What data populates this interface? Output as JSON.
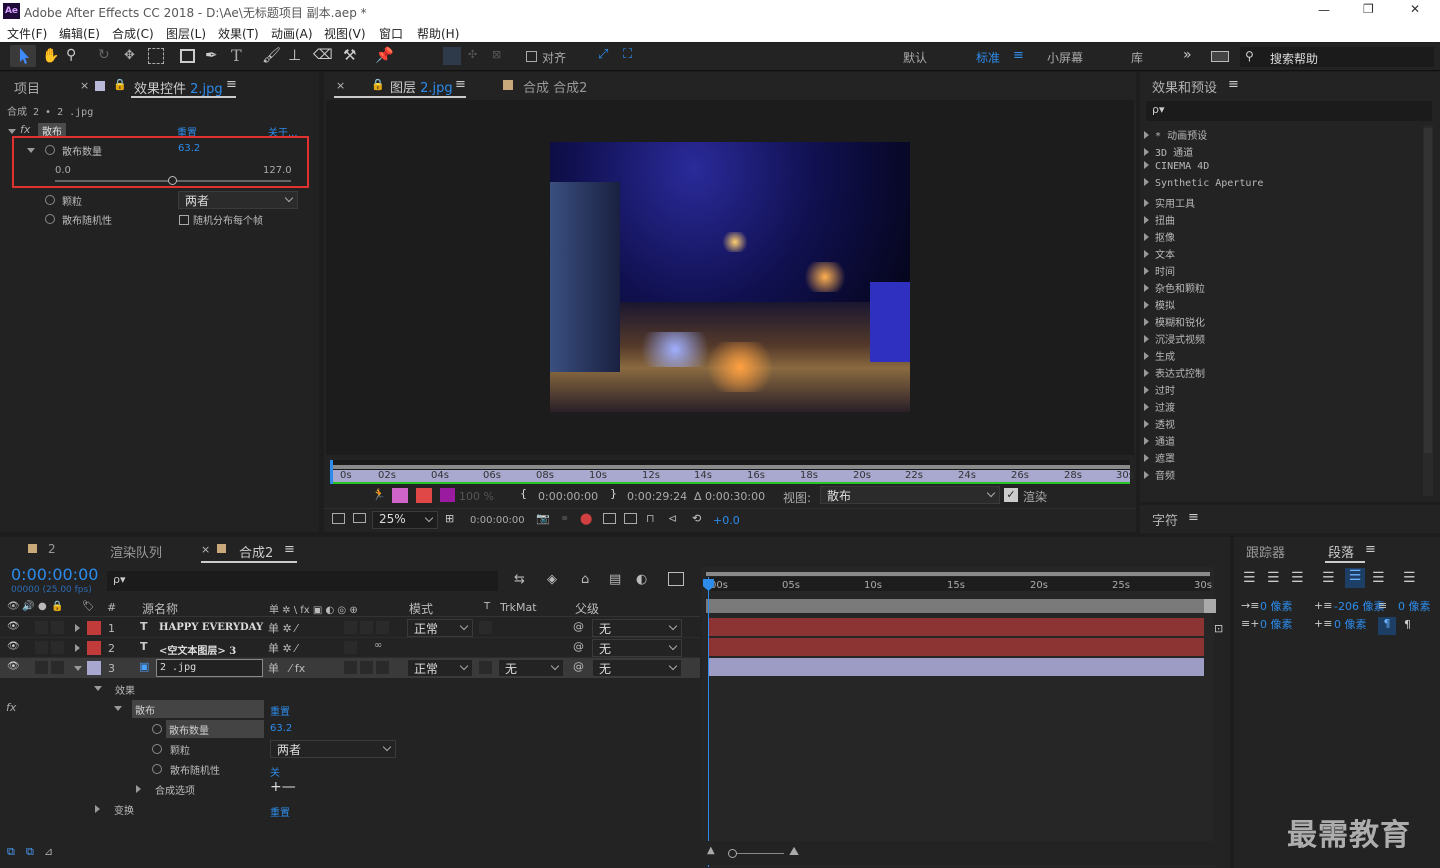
{
  "window": {
    "app_icon": "Ae",
    "title": "Adobe After Effects CC 2018 - D:\\Ae\\无标题项目 副本.aep *",
    "minimize": "—",
    "restore": "❐",
    "close": "✕"
  },
  "menu": [
    "文件(F)",
    "编辑(E)",
    "合成(C)",
    "图层(L)",
    "效果(T)",
    "动画(A)",
    "视图(V)",
    "窗口",
    "帮助(H)"
  ],
  "toolbar": {
    "align_label": "对齐",
    "workspaces": [
      "默认",
      "标准",
      "小屏幕",
      "库"
    ],
    "active_workspace": "标准",
    "more": "»",
    "search_placeholder": "搜索帮助"
  },
  "left_panel": {
    "tab_project": "项目",
    "tab_effect_controls": "效果控件",
    "effect_controls_layer": "2.jpg",
    "breadcrumb": "合成 2 • 2 .jpg",
    "effect": {
      "name": "散布",
      "reset": "重置",
      "about": "关于..."
    },
    "props": {
      "scatter_amount_label": "散布数量",
      "scatter_amount_value": "63.2",
      "slider_min": "0.0",
      "slider_max": "127.0",
      "slider_fraction": 0.497,
      "grain_label": "颗粒",
      "grain_value": "两者",
      "random_label": "散布随机性",
      "random_checkbox": "随机分布每个帧"
    }
  },
  "viewer": {
    "tab_layer": "图层",
    "tab_layer_name": "2.jpg",
    "tab_comp": "合成 合成2",
    "ruler": [
      "0s",
      "02s",
      "04s",
      "06s",
      "08s",
      "10s",
      "12s",
      "14s",
      "16s",
      "18s",
      "20s",
      "22s",
      "24s",
      "26s",
      "28s",
      "30s"
    ],
    "opacity": "100 %",
    "in_time": "0:00:00:00",
    "out_time": "0:00:29:24",
    "duration": "Δ 0:00:30:00",
    "view_label": "视图:",
    "view_value": "散布",
    "render_label": "渲染",
    "zoom": "25%",
    "current_time": "0:00:00:00",
    "exposure": "+0.0"
  },
  "effects_presets": {
    "title": "效果和预设",
    "search_placeholder": "ρ▾",
    "items": [
      "* 动画预设",
      "3D 通道",
      "CINEMA 4D",
      "Synthetic Aperture",
      "实用工具",
      "扭曲",
      "抠像",
      "文本",
      "时间",
      "杂色和颗粒",
      "模拟",
      "模糊和锐化",
      "沉浸式视频",
      "生成",
      "表达式控制",
      "过时",
      "过渡",
      "透视",
      "通道",
      "遮罩",
      "音频"
    ]
  },
  "char_panel": {
    "title": "字符"
  },
  "timeline": {
    "tabs": [
      "2",
      "渲染队列",
      "合成2"
    ],
    "timecode": "0:00:00:00",
    "fps": "00000 (25.00 fps)",
    "search_placeholder": "ρ▾",
    "columns": {
      "num": "#",
      "source": "源名称",
      "switches": "单 ✲ \\ fx ▣ ◐ ◎ ⊕",
      "mode": "模式",
      "t": "T",
      "trkmat": "TrkMat",
      "parent": "父级"
    },
    "layers": [
      {
        "num": "1",
        "type": "T",
        "name": "HAPPY EVERYDAY",
        "color": "#c23b3b",
        "mode": "正常",
        "parent": "无"
      },
      {
        "num": "2",
        "type": "T",
        "name": "<空文本图层> 3",
        "color": "#c23b3b",
        "mode": "",
        "parent": "无"
      },
      {
        "num": "3",
        "type": "▣",
        "name": "2 .jpg",
        "color": "#a7a7cf",
        "mode": "正常",
        "trkmat": "无",
        "parent": "无"
      }
    ],
    "sub": {
      "effects": "效果",
      "effect": "散布",
      "reset": "重置",
      "scatter_label": "散布数量",
      "scatter_value": "63.2",
      "grain_label": "颗粒",
      "grain_value": "两者",
      "random_label": "散布随机性",
      "random_value": "关",
      "composite": "合成选项",
      "composite_value": "+—",
      "transform": "变换",
      "transform_reset": "重置"
    },
    "ruler": [
      "00s",
      "05s",
      "10s",
      "15s",
      "20s",
      "25s",
      "30s"
    ]
  },
  "right_bottom": {
    "tab_tracker": "跟踪器",
    "tab_paragraph": "段落",
    "indent": [
      {
        "value": "0 像素"
      },
      {
        "value": "-206 像素"
      },
      {
        "value": "0 像素"
      },
      {
        "value": "0 像素"
      },
      {
        "value": "0 像素"
      }
    ]
  },
  "watermark": "最需教育",
  "colors": {
    "accent": "#2d8ceb",
    "panel": "#232323",
    "red_highlight": "#e03030",
    "layer_red": "#8c3434",
    "layer_lavender": "#9c9cc4"
  }
}
